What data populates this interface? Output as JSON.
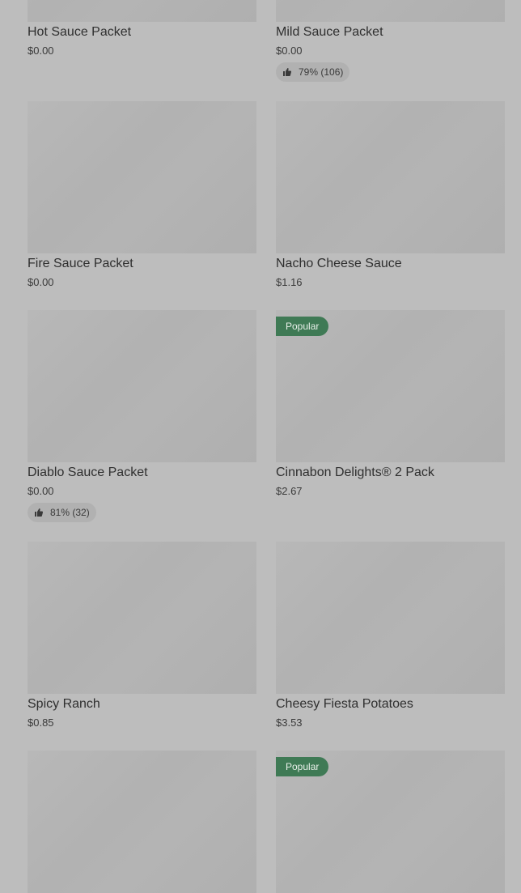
{
  "colors": {
    "page_background": "#bdbdbd",
    "placeholder": "#b4b4b4",
    "badge_background": "#3f7a55",
    "rating_background": "#b1b1b1"
  },
  "items": [
    {
      "name": "Hot Sauce Packet",
      "price": "$0.00"
    },
    {
      "name": "Mild Sauce Packet",
      "price": "$0.00",
      "rating": "79% (106)"
    },
    {
      "name": "Fire Sauce Packet",
      "price": "$0.00"
    },
    {
      "name": "Nacho Cheese Sauce",
      "price": "$1.16"
    },
    {
      "name": "Diablo Sauce Packet",
      "price": "$0.00",
      "rating": "81% (32)"
    },
    {
      "name": "Cinnabon Delights® 2 Pack",
      "price": "$2.67",
      "badge": "Popular"
    },
    {
      "name": "Spicy Ranch",
      "price": "$0.85"
    },
    {
      "name": "Cheesy Fiesta Potatoes",
      "price": "$3.53"
    },
    {
      "badge": null
    },
    {
      "badge": "Popular"
    }
  ]
}
